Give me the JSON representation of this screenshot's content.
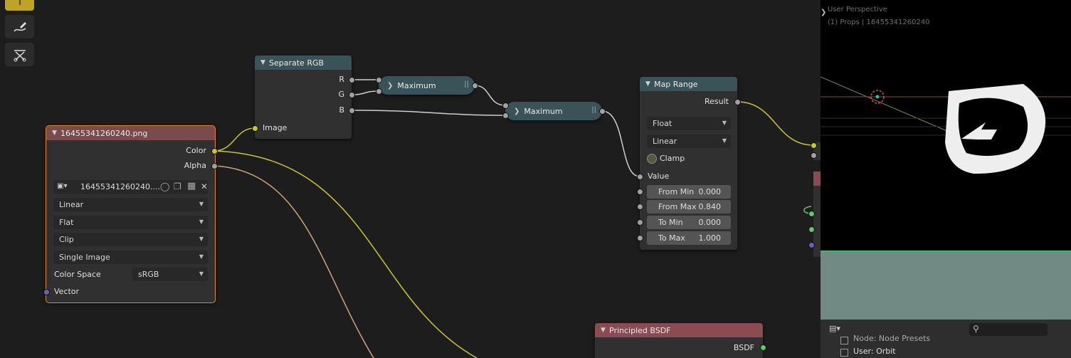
{
  "tools": [
    {
      "icon": "select-tool-icon",
      "active": true
    },
    {
      "icon": "annotate-icon",
      "active": false
    },
    {
      "icon": "cut-links-icon",
      "active": false
    }
  ],
  "image_node": {
    "title": "16455341260240.png",
    "outputs": [
      "Color",
      "Alpha"
    ],
    "image_name": "16455341260240....",
    "interpolation": "Linear",
    "projection": "Flat",
    "extension": "Clip",
    "source": "Single Image",
    "color_space_label": "Color Space",
    "color_space": "sRGB",
    "input_vector": "Vector"
  },
  "separate_rgb": {
    "title": "Separate RGB",
    "outputs": [
      "R",
      "G",
      "B"
    ],
    "input": "Image"
  },
  "maximum_1": {
    "title": "Maximum"
  },
  "maximum_2": {
    "title": "Maximum"
  },
  "map_range": {
    "title": "Map Range",
    "output": "Result",
    "data_type": "Float",
    "interpolation": "Linear",
    "clamp_label": "Clamp",
    "value_label": "Value",
    "fields": [
      {
        "label": "From Min",
        "value": "0.000"
      },
      {
        "label": "From Max",
        "value": "0.840"
      },
      {
        "label": "To Min",
        "value": "0.000"
      },
      {
        "label": "To Max",
        "value": "1.000"
      }
    ]
  },
  "principled": {
    "title": "Principled BSDF",
    "output": "BSDF"
  },
  "viewport": {
    "line1": "User Perspective",
    "line2": "(1) Props | 16455341260240"
  },
  "bottom_panel": {
    "row1": "Node: Node Presets",
    "row2": "User: Orbit"
  },
  "colors": {
    "socket_color": "#c7c729",
    "socket_gray": "#a1a1a1",
    "socket_vector": "#6363c7",
    "socket_shader": "#63c763",
    "selection": "#e0862f"
  }
}
